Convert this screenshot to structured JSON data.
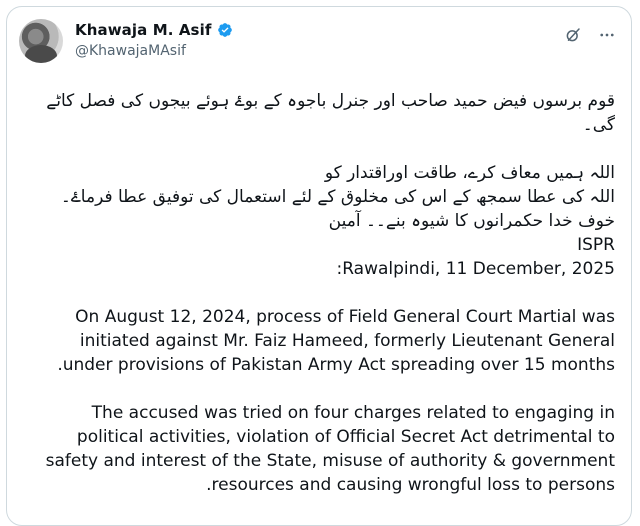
{
  "author": {
    "name": "Khawaja M. Asif",
    "handle": "@KhawajaMAsif"
  },
  "icons": {
    "verified": "verified-badge-icon",
    "grok": "grok-icon",
    "more": "more-icon"
  },
  "tweet": {
    "urdu_para1": "قوم برسوں فیض حمید صاحب اور جنرل باجوہ کے بوۓ ہوئے بیجوں کی فصل کاٹے گی۔",
    "urdu_line1": "اللہ ہمیں معاف کرے، طاقت اوراقتدار کو",
    "urdu_line2": "اللہ کی عطا سمجھ کے اس کی مخلوق کے لئے استعمال کی توفیق عطا فرماۓ۔ خوف خدا حکمرانوں کا شیوہ بنے۔۔ آمین",
    "ispr": "ISPR",
    "dateline": "Rawalpindi, 11 December, 2025:",
    "para1": "On August 12, 2024, process of Field General Court Martial was initiated against Mr. Faiz Hameed, formerly Lieutenant General under provisions of Pakistan Army Act spreading over 15 months.",
    "para2": "The accused was tried on four charges related to engaging in political activities, violation of Official Secret Act detrimental to safety and interest of the State, misuse of authority & government resources and causing wrongful loss to persons."
  }
}
